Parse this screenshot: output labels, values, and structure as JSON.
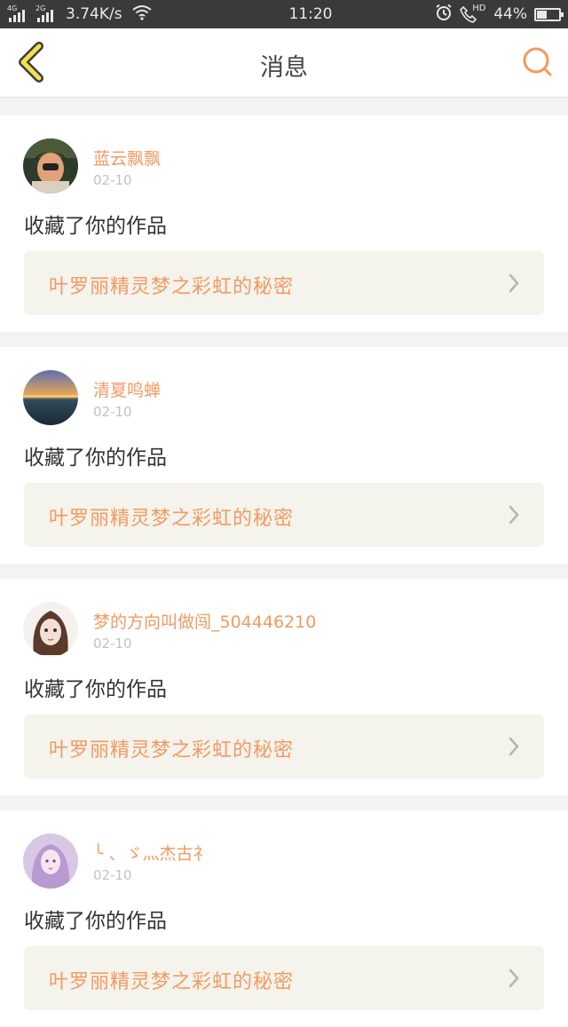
{
  "status_bar": {
    "net1": "4G",
    "net2": "2G",
    "speed": "3.74K/s",
    "time": "11:20",
    "hd": "HD",
    "battery_percent": "44%",
    "battery_level": 0.44
  },
  "header": {
    "title": "消息"
  },
  "colors": {
    "accent": "#f29a61",
    "card_link_bg": "#f4f3ec"
  },
  "messages": [
    {
      "user": "蓝云飘飘",
      "date": "02-10",
      "action": "收藏了你的作品",
      "work": "叶罗丽精灵梦之彩虹的秘密",
      "avatar": "avatar-photo-1"
    },
    {
      "user": "清夏鸣蝉",
      "date": "02-10",
      "action": "收藏了你的作品",
      "work": "叶罗丽精灵梦之彩虹的秘密",
      "avatar": "avatar-sunset"
    },
    {
      "user": "梦的方向叫做闯_504446210",
      "date": "02-10",
      "action": "收藏了你的作品",
      "work": "叶罗丽精灵梦之彩虹的秘密",
      "avatar": "avatar-girl"
    },
    {
      "user": "╰ 、ゞ灬杰古礻",
      "date": "02-10",
      "action": "收藏了你的作品",
      "work": "叶罗丽精灵梦之彩虹的秘密",
      "avatar": "avatar-purple"
    }
  ]
}
